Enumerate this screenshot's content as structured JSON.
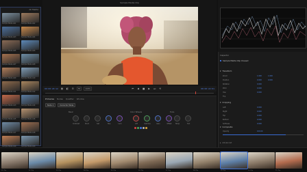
{
  "media_pool": {
    "title": "All Media",
    "clips": [
      {
        "name": "Sample Media A01",
        "color": "#7c8f9e"
      },
      {
        "name": "Sample Media A02",
        "color": "#9c7a5d"
      },
      {
        "name": "Sample Media A03",
        "color": "#4c6f9a"
      },
      {
        "name": "Sample Media A04",
        "color": "#c7894c"
      },
      {
        "name": "Sample Media A05",
        "color": "#8a6b55"
      },
      {
        "name": "Sample Media A06",
        "color": "#5d89b8"
      },
      {
        "name": "Sample Media A07",
        "color": "#a5724f"
      },
      {
        "name": "Sample Media A08",
        "color": "#6e8ea5"
      },
      {
        "name": "Sample Media A09",
        "color": "#b07d5a"
      },
      {
        "name": "Sample Media A10",
        "color": "#7f9bb4"
      },
      {
        "name": "Sample Media A11",
        "color": "#8e6a4b"
      },
      {
        "name": "Sample Media A12",
        "color": "#a9855e"
      },
      {
        "name": "Sample Media A13",
        "color": "#c36a4a"
      },
      {
        "name": "Sample Media A14",
        "color": "#5b7da2"
      },
      {
        "name": "Sample Media A15",
        "color": "#917058"
      },
      {
        "name": "Sample Media A16",
        "color": "#b59270"
      },
      {
        "name": "Sample Media A17",
        "color": "#6f8aa3"
      },
      {
        "name": "Sample Media A18",
        "color": "#9d6f50"
      },
      {
        "name": "Sample Media A19",
        "color": "#c07f55"
      },
      {
        "name": "Sample Media A20",
        "color": "#7c96ad"
      }
    ]
  },
  "viewer": {
    "title": "Sample Media Clip",
    "timecode_left": "00:00:20:12",
    "timecode_right": "00:00:22:01",
    "fit_label": "Fit",
    "zoom_label": "100%"
  },
  "nodes_panel": {
    "tabs": [
      "Primaries",
      "Nodes",
      "Qualifier",
      "Window"
    ],
    "node_label": "Node 1",
    "mode_label": "Corrector Mode",
    "group_basic": "Basic",
    "group_color": "Color Wheels",
    "group_extra": "Tools",
    "knobs": [
      "Contrast",
      "Pivot",
      "Sat",
      "Hue",
      "Lum",
      "Lift",
      "Gamma",
      "Gain",
      "Offset",
      "Temp",
      "Tint"
    ]
  },
  "inspector": {
    "header": "Inspector",
    "clip_name": "Sample Media Clip Unused",
    "section_transform": "Transform",
    "rows": [
      {
        "label": "Zoom",
        "v1": "1.000",
        "v2": "1.000"
      },
      {
        "label": "Position",
        "v1": "0.000",
        "v2": "0.000"
      },
      {
        "label": "Rotation",
        "v1": "0.000",
        "v2": ""
      },
      {
        "label": "Pitch",
        "v1": "0.000",
        "v2": ""
      },
      {
        "label": "Yaw",
        "v1": "0.000",
        "v2": ""
      },
      {
        "label": "Flip",
        "v1": "",
        "v2": ""
      }
    ],
    "section_crop": "Cropping",
    "crop_rows": [
      {
        "label": "Left",
        "v1": "0.000"
      },
      {
        "label": "Right",
        "v1": "0.000"
      },
      {
        "label": "Top",
        "v1": "0.000"
      },
      {
        "label": "Bottom",
        "v1": "0.000"
      },
      {
        "label": "Softness",
        "v1": "0.000"
      }
    ],
    "section_composite": "Composite",
    "opacity_label": "Opacity",
    "opacity_value": "100.00",
    "opacity_fraction": 0.78,
    "footer": "Advanced"
  },
  "filmstrip": {
    "active_index": 8,
    "thumbs": [
      {
        "name": "01 Clip",
        "color": "#8a7b6d"
      },
      {
        "name": "02 Clip",
        "color": "#6a8aa8"
      },
      {
        "name": "03 Clip",
        "color": "#b5925f"
      },
      {
        "name": "04 Clip",
        "color": "#c49a6a"
      },
      {
        "name": "05 Clip",
        "color": "#a28a6f"
      },
      {
        "name": "06 Clip",
        "color": "#7f6a55"
      },
      {
        "name": "07 Clip",
        "color": "#9aa7b3"
      },
      {
        "name": "08 Clip",
        "color": "#94826c"
      },
      {
        "name": "09 Clip",
        "color": "#5e7fa6"
      },
      {
        "name": "10 Clip",
        "color": "#8c7b69"
      },
      {
        "name": "11 Clip",
        "color": "#b36b4e"
      }
    ]
  }
}
